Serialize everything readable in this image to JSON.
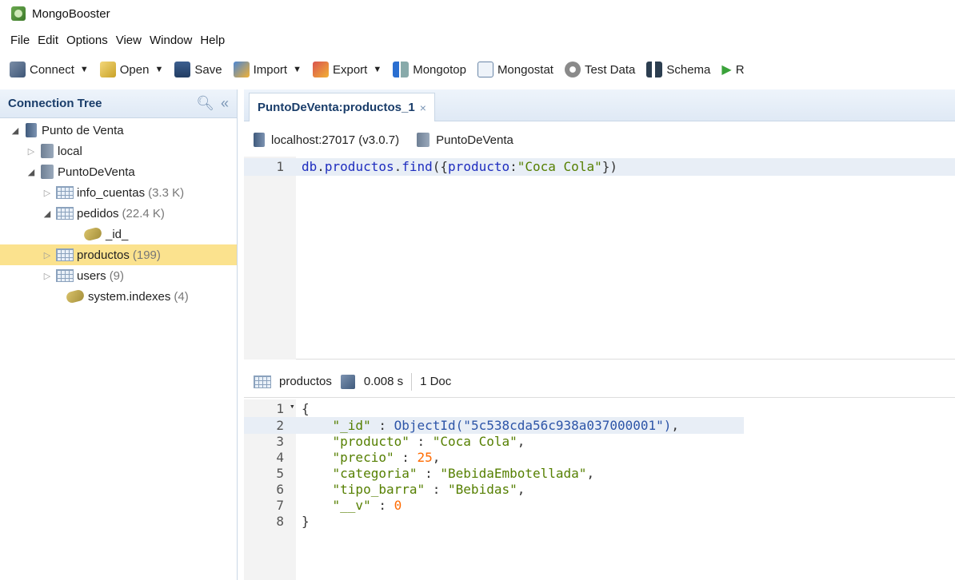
{
  "app": {
    "title": "MongoBooster"
  },
  "menu": [
    "File",
    "Edit",
    "Options",
    "View",
    "Window",
    "Help"
  ],
  "toolbar": {
    "connect": "Connect",
    "open": "Open",
    "save": "Save",
    "import": "Import",
    "export": "Export",
    "mongotop": "Mongotop",
    "mongostat": "Mongostat",
    "test_data": "Test Data",
    "schema": "Schema",
    "run": "R"
  },
  "connection_tree": {
    "title": "Connection Tree",
    "items": [
      {
        "label": "Punto de Venta",
        "count": ""
      },
      {
        "label": "local",
        "count": ""
      },
      {
        "label": "PuntoDeVenta",
        "count": ""
      },
      {
        "label": "info_cuentas",
        "count": "(3.3 K)"
      },
      {
        "label": "pedidos",
        "count": "(22.4 K)"
      },
      {
        "label": "_id_",
        "count": ""
      },
      {
        "label": "productos",
        "count": "(199)"
      },
      {
        "label": "users",
        "count": "(9)"
      },
      {
        "label": "system.indexes",
        "count": "(4)"
      }
    ]
  },
  "tab": {
    "label": "PuntoDeVenta:productos_1",
    "close": "×"
  },
  "connection": {
    "server": "localhost:27017 (v3.0.7)",
    "database": "PuntoDeVenta"
  },
  "editor": {
    "line_number": "1",
    "db": "db",
    "collection": "productos",
    "method": "find",
    "field": "producto",
    "value": "\"Coca Cola\""
  },
  "result_bar": {
    "collection": "productos",
    "time": "0.008 s",
    "docs": "1 Doc"
  },
  "result": {
    "line_numbers": [
      "1",
      "2",
      "3",
      "4",
      "5",
      "6",
      "7",
      "8"
    ],
    "id_key": "\"_id\"",
    "id_value": "ObjectId(\"5c538cda56c938a037000001\")",
    "producto_key": "\"producto\"",
    "producto_value": "\"Coca Cola\"",
    "precio_key": "\"precio\"",
    "precio_value": "25",
    "categoria_key": "\"categoria\"",
    "categoria_value": "\"BebidaEmbotellada\"",
    "tipo_barra_key": "\"tipo_barra\"",
    "tipo_barra_value": "\"Bebidas\"",
    "v_key": "\"__v\"",
    "v_value": "0"
  }
}
